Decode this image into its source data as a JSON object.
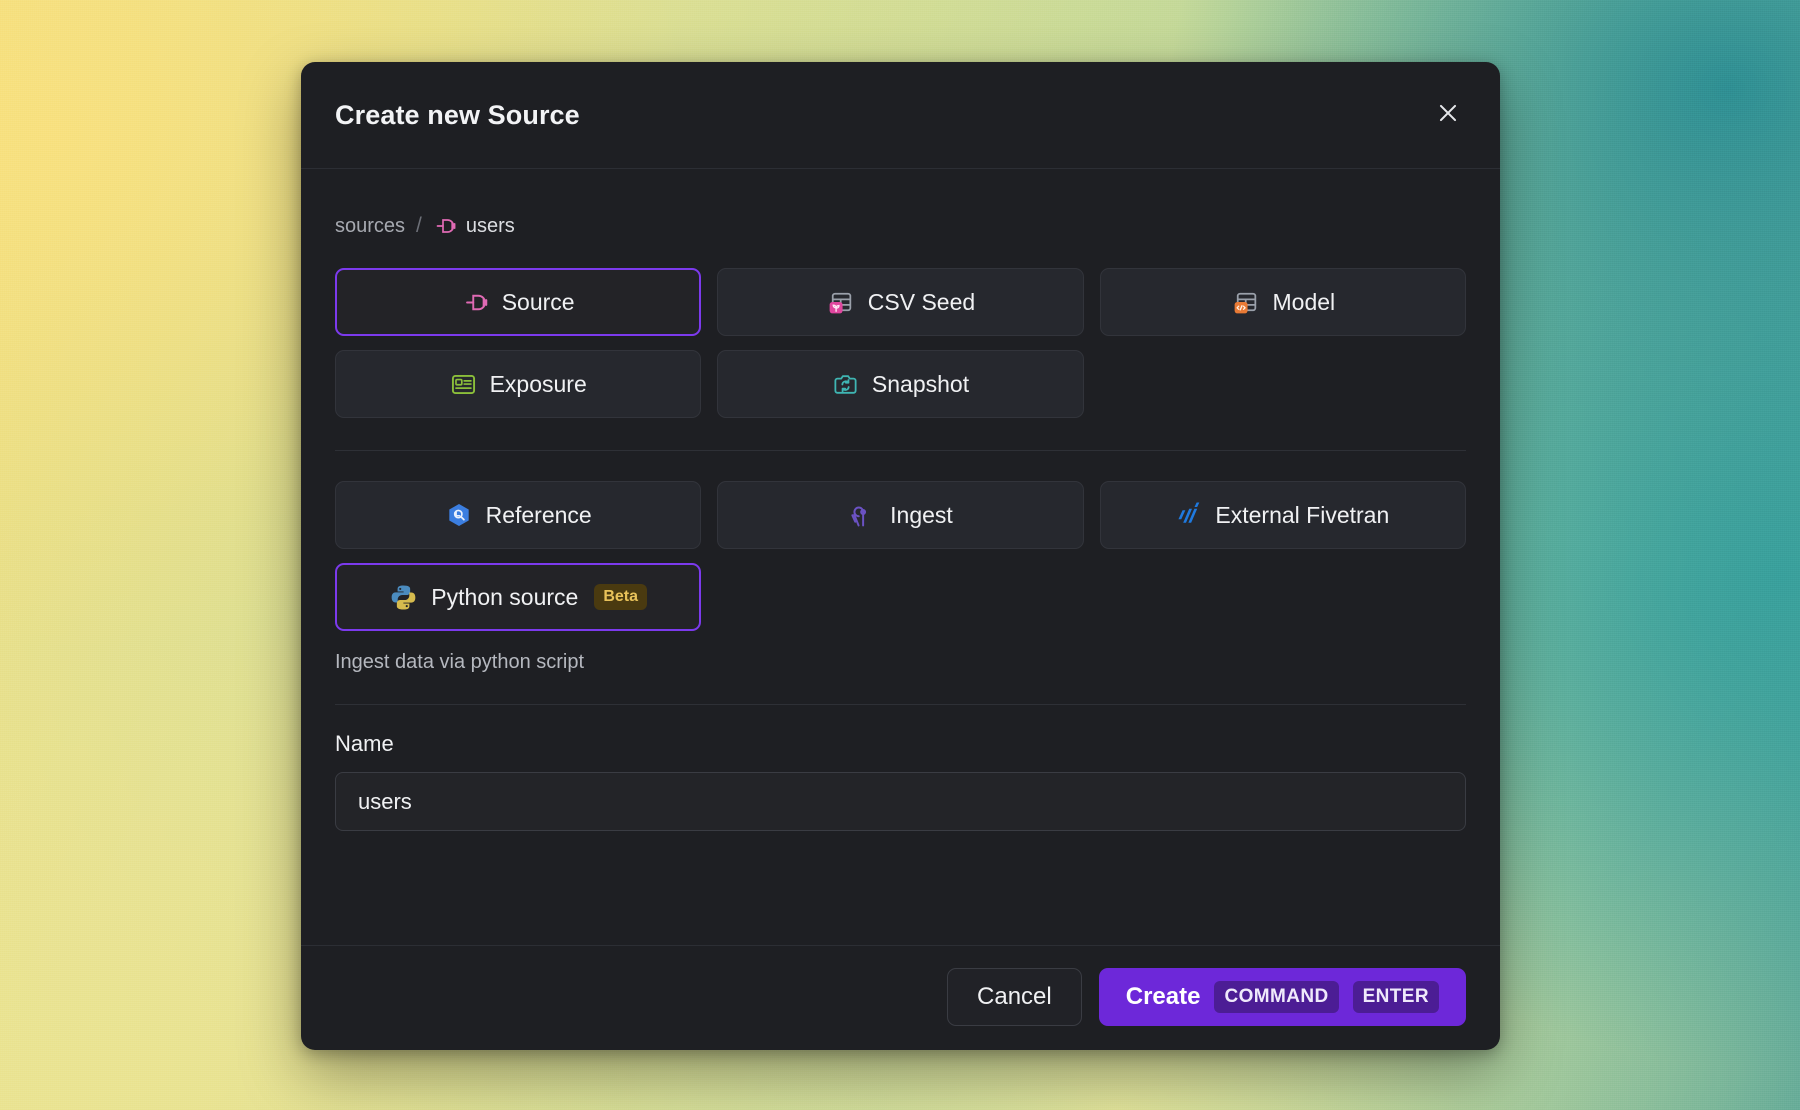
{
  "colors": {
    "accent": "#6d28d9",
    "accent_border": "#7c3aed",
    "modal_bg": "#1e1f23",
    "option_bg": "#26282e",
    "beta_badge_bg": "#4a3a10",
    "beta_badge_fg": "#e8c25a",
    "source_icon": "#e06ab4",
    "seed_badge": "#e0469e",
    "model_badge": "#e87a35",
    "exposure_icon": "#8bbf3a",
    "snapshot_icon": "#3fb6b3",
    "reference_icon": "#3b7ee0",
    "ingest_icon": "#6b52c4",
    "fivetran_icon": "#1f7ae0",
    "python_blue": "#4b8bbe",
    "python_yellow": "#d6bb4e"
  },
  "header": {
    "title": "Create new Source",
    "close_icon": "close-icon"
  },
  "breadcrumb": {
    "root": "sources",
    "separator": "/",
    "current": "users",
    "current_icon": "source-plug-icon"
  },
  "options": [
    {
      "id": "source",
      "label": "Source",
      "icon": "source-plug-icon",
      "selected": true,
      "badge": null
    },
    {
      "id": "csv-seed",
      "label": "CSV Seed",
      "icon": "seed-table-icon",
      "selected": false,
      "badge": null
    },
    {
      "id": "model",
      "label": "Model",
      "icon": "model-table-icon",
      "selected": false,
      "badge": null
    },
    {
      "id": "exposure",
      "label": "Exposure",
      "icon": "exposure-icon",
      "selected": false,
      "badge": null
    },
    {
      "id": "snapshot",
      "label": "Snapshot",
      "icon": "snapshot-icon",
      "selected": false,
      "badge": null
    }
  ],
  "options_secondary": [
    {
      "id": "reference",
      "label": "Reference",
      "icon": "reference-icon",
      "selected": false,
      "badge": null
    },
    {
      "id": "ingest",
      "label": "Ingest",
      "icon": "ingest-icon",
      "selected": false,
      "badge": null
    },
    {
      "id": "external-fivetran",
      "label": "External Fivetran",
      "icon": "fivetran-icon",
      "selected": false,
      "badge": null
    },
    {
      "id": "python-source",
      "label": "Python source",
      "icon": "python-icon",
      "selected": true,
      "badge": "Beta"
    }
  ],
  "helper_text": "Ingest data via python script",
  "name_field": {
    "label": "Name",
    "value": "users",
    "placeholder": "Name"
  },
  "footer": {
    "cancel_label": "Cancel",
    "create_label": "Create",
    "shortcut_modifier": "COMMAND",
    "shortcut_key": "ENTER"
  }
}
